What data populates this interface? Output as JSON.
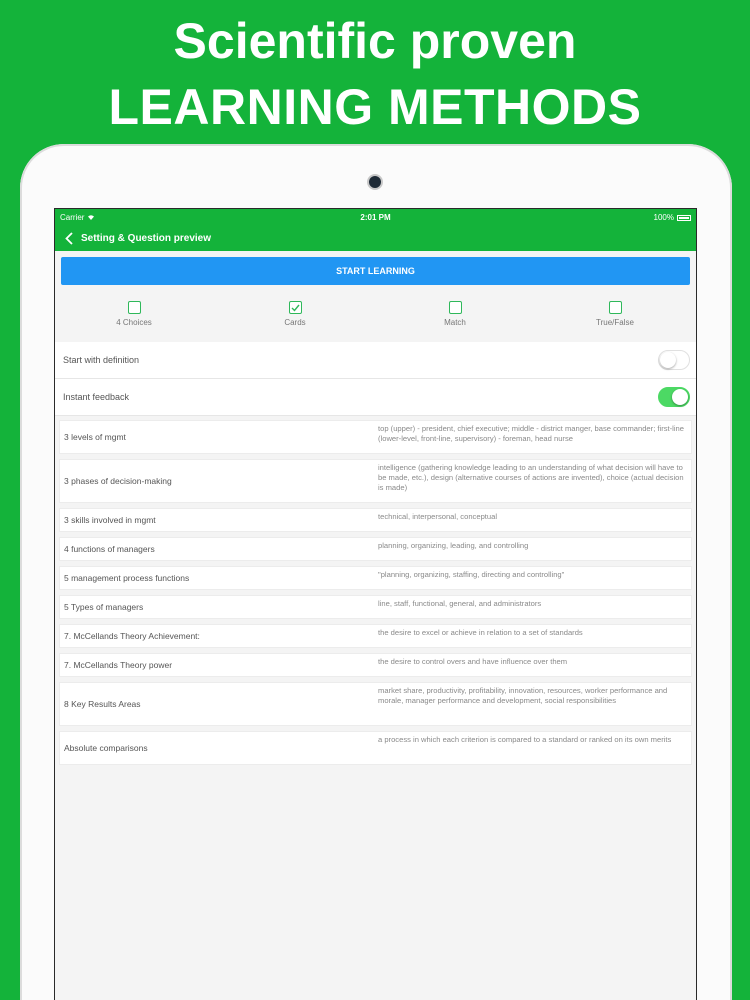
{
  "promo": {
    "line1": "Scientific proven",
    "line2": "LEARNING METHODS"
  },
  "status_bar": {
    "carrier": "Carrier",
    "time": "2:01 PM",
    "battery": "100%"
  },
  "nav": {
    "title": "Setting & Question preview"
  },
  "start_button": "START LEARNING",
  "modes": [
    {
      "label": "4 Choices",
      "checked": false
    },
    {
      "label": "Cards",
      "checked": true
    },
    {
      "label": "Match",
      "checked": false
    },
    {
      "label": "True/False",
      "checked": false
    }
  ],
  "settings": [
    {
      "label": "Start with definition",
      "on": false
    },
    {
      "label": "Instant feedback",
      "on": true
    }
  ],
  "cards": [
    {
      "term": "3 levels of mgmt",
      "definition": "top (upper) - president, chief executive; middle - district manger, base commander; first-line (lower-level, front-line, supervisory) - foreman, head nurse"
    },
    {
      "term": "3 phases of decision-making",
      "definition": "intelligence (gathering knowledge leading to an understanding of what decision will have to be made, etc.), design (alternative courses of actions are invented), choice (actual decision is made)"
    },
    {
      "term": "3 skills involved in mgmt",
      "definition": "technical, interpersonal, conceptual"
    },
    {
      "term": "4 functions of managers",
      "definition": "planning, organizing, leading, and controlling"
    },
    {
      "term": "5 management process functions",
      "definition": "\"planning, organizing, staffing, directing and controlling\""
    },
    {
      "term": "5 Types of managers",
      "definition": "line, staff, functional, general, and administrators"
    },
    {
      "term": "7. McCellands Theory Achievement:",
      "definition": "the desire to excel or achieve in relation to a set of standards"
    },
    {
      "term": "7. McCellands Theory power",
      "definition": "the desire to control overs and have influence over them"
    },
    {
      "term": "8 Key Results Areas",
      "definition": "market share, productivity, profitability, innovation, resources, worker performance and morale, manager performance and development, social responsibilities"
    },
    {
      "term": "Absolute comparisons",
      "definition": "a process in which each criterion is compared to a standard or ranked on its own merits"
    }
  ],
  "colors": {
    "brand_green": "#14b33a",
    "button_blue": "#2196f3",
    "toggle_on": "#4cd964"
  }
}
